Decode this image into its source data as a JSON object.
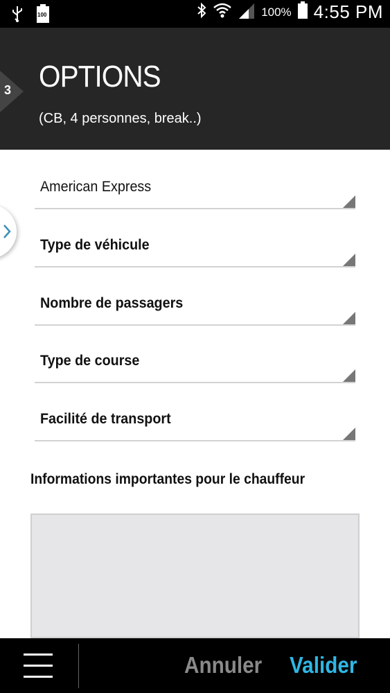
{
  "status_bar": {
    "battery_small_label": "100",
    "battery_percent": "100%",
    "time": "4:55 PM",
    "icons": [
      "usb-icon",
      "battery-small-icon",
      "bluetooth-icon",
      "wifi-icon",
      "signal-icon",
      "battery-icon"
    ]
  },
  "header": {
    "step": "3",
    "title": "OPTIONS",
    "subtitle": "(CB, 4 personnes, break..)"
  },
  "form": {
    "fields": [
      {
        "label": "American Express",
        "bold": false
      },
      {
        "label": "Type de véhicule",
        "bold": true
      },
      {
        "label": "Nombre de passagers",
        "bold": true
      },
      {
        "label": "Type de course",
        "bold": true
      },
      {
        "label": "Facilité de transport",
        "bold": true
      }
    ],
    "info_label": "Informations importantes pour le chauffeur",
    "info_value": ""
  },
  "bottom_bar": {
    "cancel_label": "Annuler",
    "validate_label": "Valider"
  },
  "colors": {
    "header_bg": "#262626",
    "accent": "#2fb7e4",
    "cancel": "#8a8a8a",
    "textarea_bg": "#e6e6e8"
  }
}
